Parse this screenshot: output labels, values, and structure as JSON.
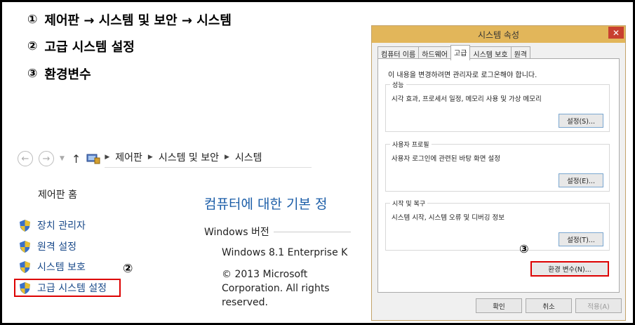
{
  "steps": [
    {
      "num": "①",
      "text": "제어판 → 시스템 및 보안 → 시스템"
    },
    {
      "num": "②",
      "text": "고급 시스템 설정"
    },
    {
      "num": "③",
      "text": "환경변수"
    }
  ],
  "explorer": {
    "breadcrumb": [
      "제어판",
      "시스템 및 보안",
      "시스템"
    ],
    "sidebar_home": "제어판 홈",
    "sidebar_items": [
      "장치 관리자",
      "원격 설정",
      "시스템 보호",
      "고급 시스템 설정"
    ],
    "marker2": "②",
    "main_title": "컴퓨터에 대한 기본 정",
    "windows_version_label": "Windows 버전",
    "windows_edition": "Windows 8.1 Enterprise K",
    "copyright": "© 2013 Microsoft Corporation. All rights reserved."
  },
  "dialog": {
    "title": "시스템 속성",
    "close": "✕",
    "tabs": [
      "컴퓨터 이름",
      "하드웨어",
      "고급",
      "시스템 보호",
      "원격"
    ],
    "admin_note": "이 내용을 변경하려면 관리자로 로그온해야 합니다.",
    "groups": [
      {
        "title": "성능",
        "desc": "시각 효과, 프로세서 일정, 메모리 사용 및 가상 메모리",
        "button": "설정(S)..."
      },
      {
        "title": "사용자 프로필",
        "desc": "사용자 로그인에 관련된 바탕 화면 설정",
        "button": "설정(E)..."
      },
      {
        "title": "시작 및 복구",
        "desc": "시스템 시작, 시스템 오류 및 디버깅 정보",
        "button": "설정(T)..."
      }
    ],
    "marker3": "③",
    "env_button": "환경 변수(N)...",
    "ok": "확인",
    "cancel": "취소",
    "apply": "적용(A)"
  }
}
